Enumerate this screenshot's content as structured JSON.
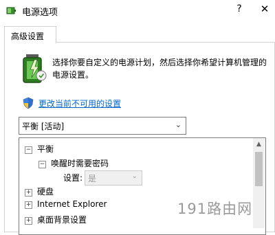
{
  "window": {
    "title": "电源选项",
    "help_label": "?",
    "close_label": "✕"
  },
  "tabs": [
    {
      "label": "高级设置"
    }
  ],
  "description": "选择你要自定义的电源计划，然后选择你希望计算机管理的电源设置。",
  "change_link": "更改当前不可用的设置",
  "plan_select": {
    "value": "平衡 [活动]"
  },
  "tree": {
    "items": [
      {
        "label": "平衡",
        "expander": "⊟"
      },
      {
        "label": "唤醒时需要密码",
        "expander": "⊟"
      },
      {
        "label": "设置:",
        "value": "是"
      },
      {
        "label": "硬盘",
        "expander": "⊞"
      },
      {
        "label": "Internet Explorer",
        "expander": "⊞"
      },
      {
        "label": "桌面背景设置",
        "expander": "⊞"
      }
    ]
  },
  "watermark": "191路由网",
  "colors": {
    "link": "#0066cc",
    "border": "#7a7a7a"
  }
}
